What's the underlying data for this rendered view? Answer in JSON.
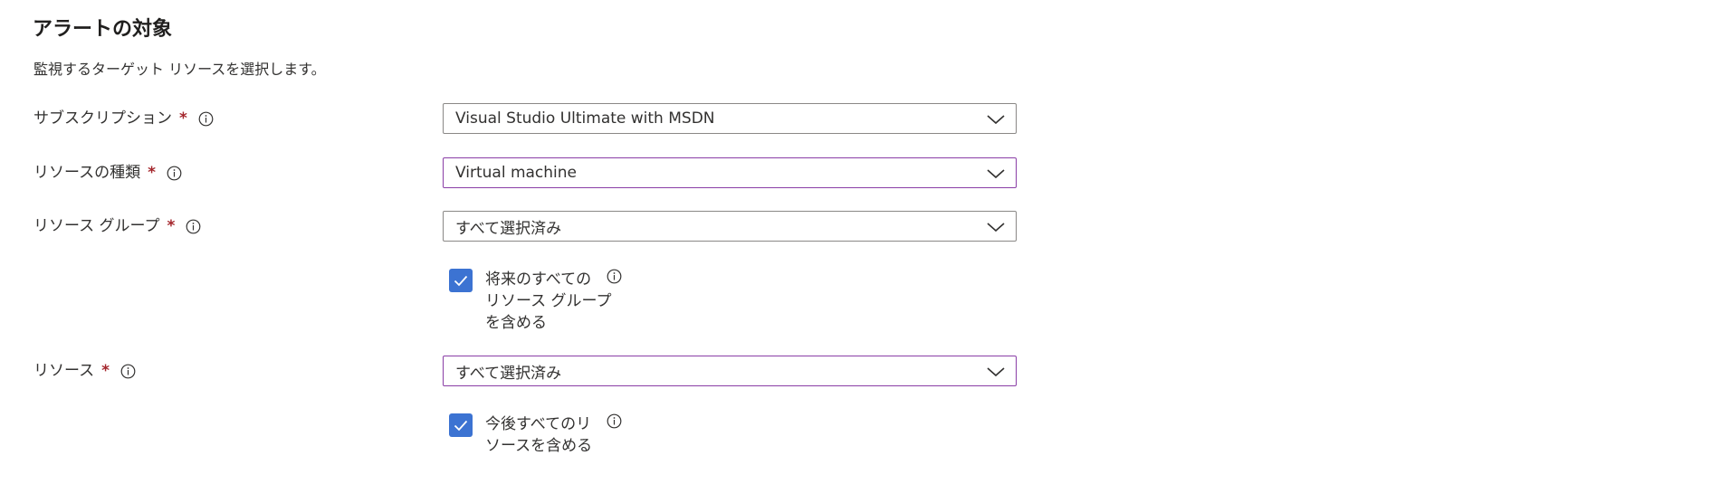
{
  "section": {
    "title": "アラートの対象",
    "description": "監視するターゲット リソースを選択します。"
  },
  "fields": {
    "subscription": {
      "label": "サブスクリプション",
      "required_mark": "*",
      "value": "Visual Studio Ultimate with MSDN"
    },
    "resource_type": {
      "label": "リソースの種類",
      "required_mark": "*",
      "value": "Virtual machine"
    },
    "resource_group": {
      "label": "リソース グループ",
      "required_mark": "*",
      "value": "すべて選択済み",
      "include_future": {
        "checked": true,
        "label_lines": [
          "将来のすべての",
          "リソース グループ",
          "を含める"
        ]
      }
    },
    "resource": {
      "label": "リソース",
      "required_mark": "*",
      "value": "すべて選択済み",
      "include_future": {
        "checked": true,
        "label_lines": [
          "今後すべてのリ",
          "ソースを含める"
        ]
      }
    }
  },
  "colors": {
    "required": "#a4262c",
    "checkbox": "#3c73d2",
    "focus_border": "#8a3ea6",
    "default_border": "#8a8886"
  },
  "icons": {
    "info": "info-icon",
    "dropdown": "chevron-down-icon",
    "check": "checkmark-icon"
  }
}
